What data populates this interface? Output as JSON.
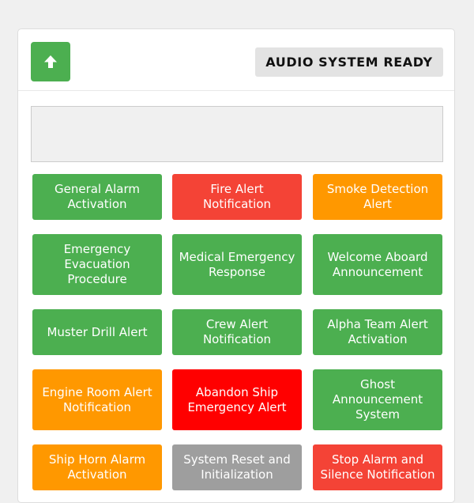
{
  "header": {
    "status_text": "AUDIO SYSTEM READY"
  },
  "colors": {
    "green": "#4caf50",
    "red": "#f44336",
    "orange": "#ff9800",
    "bright_red": "#ff0000",
    "gray": "#9e9e9e"
  },
  "icons": {
    "up_button": "arrow-up-icon"
  },
  "alerts": [
    {
      "label": "General Alarm Activation",
      "color": "green"
    },
    {
      "label": "Fire Alert Notification",
      "color": "red"
    },
    {
      "label": "Smoke Detection Alert",
      "color": "orange"
    },
    {
      "label": "Emergency Evacuation Procedure",
      "color": "green"
    },
    {
      "label": "Medical Emergency Response",
      "color": "green"
    },
    {
      "label": "Welcome Aboard Announcement",
      "color": "green"
    },
    {
      "label": "Muster Drill Alert",
      "color": "green"
    },
    {
      "label": "Crew Alert Notification",
      "color": "green"
    },
    {
      "label": "Alpha Team Alert Activation",
      "color": "green"
    },
    {
      "label": "Engine Room Alert Notification",
      "color": "orange"
    },
    {
      "label": "Abandon Ship Emergency Alert",
      "color": "bright-red"
    },
    {
      "label": "Ghost Announcement System",
      "color": "green"
    },
    {
      "label": "Ship Horn Alarm Activation",
      "color": "orange"
    },
    {
      "label": "System Reset and Initialization",
      "color": "gray"
    },
    {
      "label": "Stop Alarm and Silence Notification",
      "color": "red"
    }
  ]
}
